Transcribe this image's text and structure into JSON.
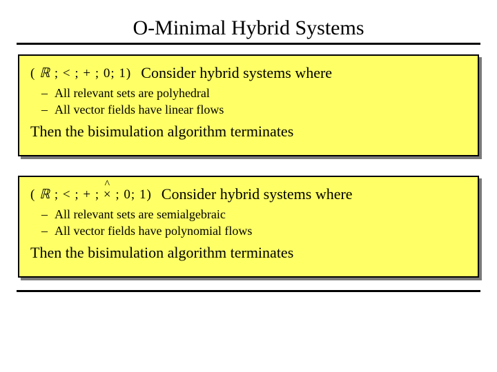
{
  "title": "O-Minimal Hybrid Systems",
  "panels": [
    {
      "formula_html": "( <span class='ital'>ℝ</span> ; < ; + ; 0; 1)",
      "lead": "Consider hybrid systems where",
      "bullets": [
        "All  relevant sets are polyhedral",
        "All vector fields have linear flows"
      ],
      "conclusion": "Then the bisimulation algorithm terminates"
    },
    {
      "formula_html": "( <span class='ital'>ℝ</span> ; < ; + ; <span class='hat'>×</span> ; 0; 1)",
      "lead": "Consider hybrid systems where",
      "bullets": [
        "All  relevant sets are semialgebraic",
        "All vector fields have polynomial flows"
      ],
      "conclusion": "Then the bisimulation algorithm terminates"
    }
  ]
}
